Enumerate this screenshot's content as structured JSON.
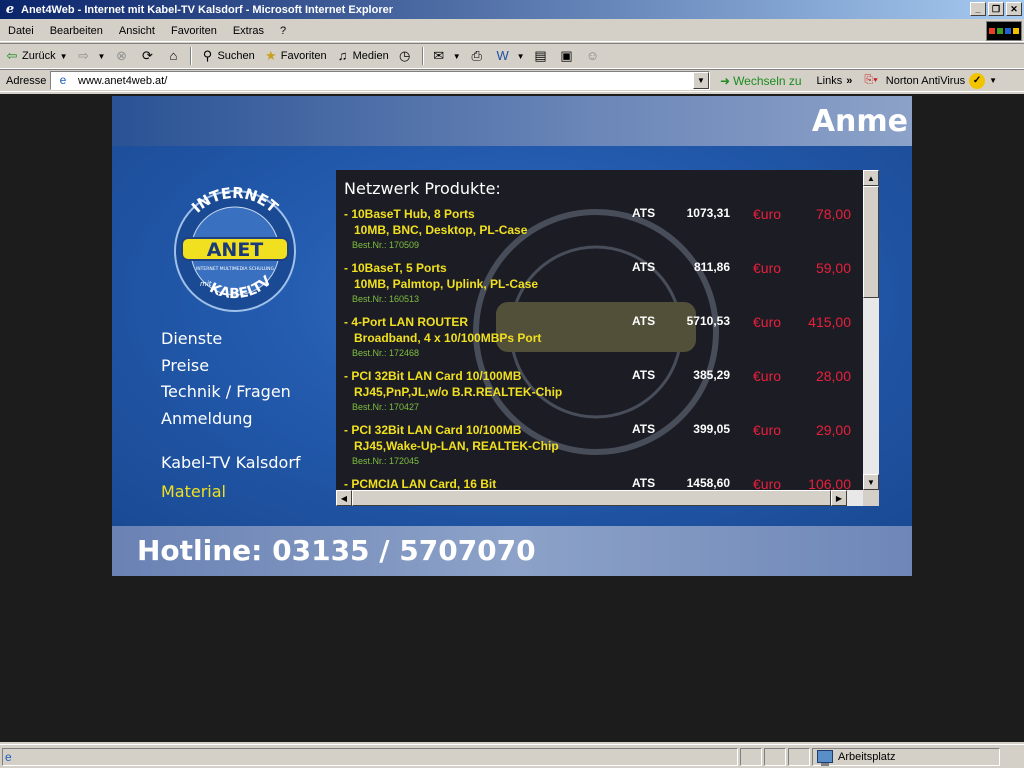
{
  "window": {
    "title": "Anet4Web - Internet mit Kabel-TV Kalsdorf - Microsoft Internet Explorer",
    "minimize": "_",
    "restore": "❐",
    "close": "✕"
  },
  "menu": {
    "items": [
      "Datei",
      "Bearbeiten",
      "Ansicht",
      "Favoriten",
      "Extras",
      "?"
    ]
  },
  "toolbar": {
    "back_label": "Zurück",
    "search_label": "Suchen",
    "favorites_label": "Favoriten",
    "media_label": "Medien"
  },
  "address": {
    "label": "Adresse",
    "url": "www.anet4web.at/",
    "go_label": "Wechseln zu",
    "links_label": "Links",
    "norton_label": "Norton AntiVirus"
  },
  "site": {
    "header_text": "Anme",
    "logo": {
      "top_text": "INTERNET",
      "brand": "ANET",
      "tagline": "INTERNET MULTIMEDIA SCHULUNG",
      "mit": "mit",
      "bottom_text": "KABELTV"
    },
    "nav": {
      "dienste": "Dienste",
      "preise": "Preise",
      "technik": "Technik / Fragen",
      "anmeldung": "Anmeldung",
      "kabeltv": "Kabel-TV Kalsdorf",
      "material": "Material"
    },
    "products": {
      "title": "Netzwerk Produkte:",
      "currency_ats": "ATS",
      "currency_eur": "€uro",
      "items": [
        {
          "name": "- 10BaseT Hub, 8 Ports\n   10MB, BNC, Desktop, PL-Case",
          "best": "Best.Nr.: 170509",
          "ats": "1073,31",
          "eur": "78,00"
        },
        {
          "name": "- 10BaseT, 5 Ports\n   10MB, Palmtop, Uplink, PL-Case",
          "best": "Best.Nr.: 160513",
          "ats": "811,86",
          "eur": "59,00"
        },
        {
          "name": "- 4-Port LAN ROUTER\n   Broadband, 4 x 10/100MBPs Port",
          "best": "Best.Nr.: 172468",
          "ats": "5710,53",
          "eur": "415,00"
        },
        {
          "name": "- PCI 32Bit LAN Card 10/100MB\n   RJ45,PnP,JL,w/o B.R.REALTEK-Chip",
          "best": "Best.Nr.: 170427",
          "ats": "385,29",
          "eur": "28,00"
        },
        {
          "name": "- PCI 32Bit LAN Card 10/100MB\n   RJ45,Wake-Up-LAN, REALTEK-Chip",
          "best": "Best.Nr.: 172045",
          "ats": "399,05",
          "eur": "29,00"
        },
        {
          "name": "- PCMCIA LAN Card, 16 Bit",
          "best": "",
          "ats": "1458,60",
          "eur": "106,00"
        }
      ]
    },
    "hotline": "Hotline: 03135 / 5707070"
  },
  "status": {
    "zone_label": "Arbeitsplatz"
  },
  "colors": {
    "accent_yellow": "#f0e020",
    "price_red": "#e8203c",
    "site_blue": "#1e4f9a"
  }
}
